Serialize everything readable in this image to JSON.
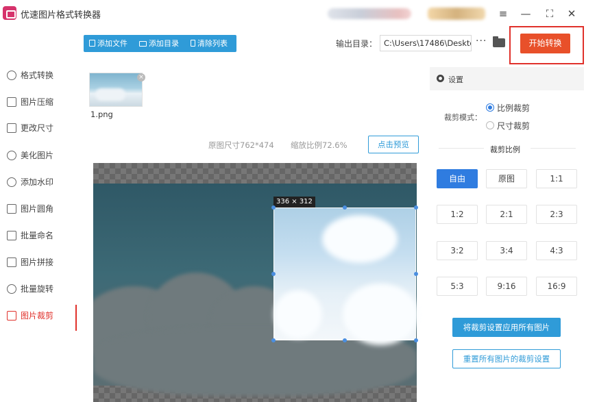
{
  "window": {
    "title": "优速图片格式转换器",
    "controls": {
      "menu": "≡",
      "minimize": "—",
      "maximize": "⛶",
      "close": "✕"
    }
  },
  "toolbar": {
    "add_file": "添加文件",
    "add_folder": "添加目录",
    "clear_list": "清除列表",
    "output_label": "输出目录：",
    "output_path": "C:\\Users\\17486\\Deskto",
    "more": "···",
    "start": "开始转换"
  },
  "sidebar": {
    "items": [
      {
        "label": "格式转换",
        "icon": "format-icon"
      },
      {
        "label": "图片压缩",
        "icon": "compress-icon"
      },
      {
        "label": "更改尺寸",
        "icon": "resize-icon"
      },
      {
        "label": "美化图片",
        "icon": "beautify-icon"
      },
      {
        "label": "添加水印",
        "icon": "watermark-icon"
      },
      {
        "label": "图片圆角",
        "icon": "round-corner-icon"
      },
      {
        "label": "批量命名",
        "icon": "rename-icon"
      },
      {
        "label": "图片拼接",
        "icon": "stitch-icon"
      },
      {
        "label": "批量旋转",
        "icon": "rotate-icon"
      },
      {
        "label": "图片裁剪",
        "icon": "crop-icon"
      }
    ],
    "active": "图片裁剪"
  },
  "main": {
    "thumbnail": {
      "filename": "1.png",
      "remove": "×"
    },
    "original_size": "原图尺寸762*474",
    "scale": "缩放比例72.6%",
    "preview": "点击预览",
    "crop_dimensions": "336 × 312"
  },
  "panel": {
    "title": "设置",
    "crop_mode_label": "裁剪模式：",
    "mode_ratio": "比例裁剪",
    "mode_size": "尺寸裁剪",
    "selected_mode": "比例裁剪",
    "ratio_title": "裁剪比例",
    "ratios": [
      "自由",
      "原图",
      "1:1",
      "1:2",
      "2:1",
      "2:3",
      "3:2",
      "3:4",
      "4:3",
      "5:3",
      "9:16",
      "16:9"
    ],
    "active_ratio": "自由",
    "apply_all": "将裁剪设置应用所有图片",
    "reset_all": "重置所有图片的裁剪设置"
  },
  "colors": {
    "primary": "#2f9bd8",
    "start": "#e8502a",
    "highlight": "#e0302a",
    "active_ratio": "#2f7ce0"
  }
}
